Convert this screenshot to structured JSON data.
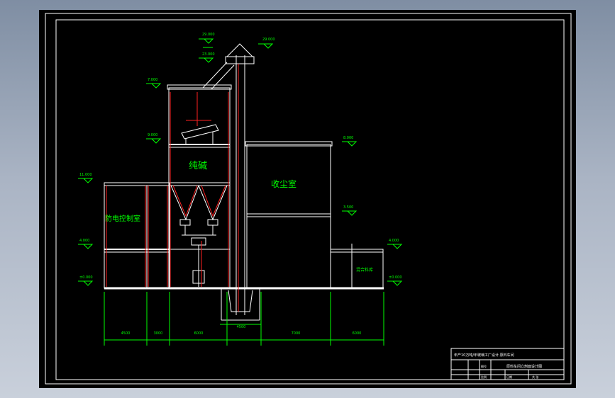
{
  "rooms": {
    "soda": "纯碱",
    "dust": "收尘室",
    "control": "防电控制室",
    "batch": "混合料库"
  },
  "elevations": {
    "e_top_a": "29.000",
    "e_top_b": "29.000",
    "e_head": "23.000",
    "e_roof": "7.000",
    "e_mid_l": "9.000",
    "e_mid_r": "8.000",
    "e_ctrl": "11.000",
    "e_floor_r": "3.500",
    "e_low_l": "4.000",
    "e_low_r": "4.000",
    "e_base_l": "±0.000",
    "e_base_r": "±0.000"
  },
  "dimensions": [
    "4500",
    "3000",
    "6000",
    "4500",
    "7000",
    "6000"
  ],
  "title_block": {
    "project": "年产10万吨/年玻璃工厂设计·原料车间",
    "drawing": "原料车间立剖面设计图",
    "cell_a": "图号",
    "cell_b": "比例",
    "cell_c": "日期",
    "cell_d": "共 张"
  },
  "colors": {
    "line": "#ffffff",
    "dim": "#00ff00",
    "accent": "#ff2020",
    "label": "#00ff00"
  }
}
